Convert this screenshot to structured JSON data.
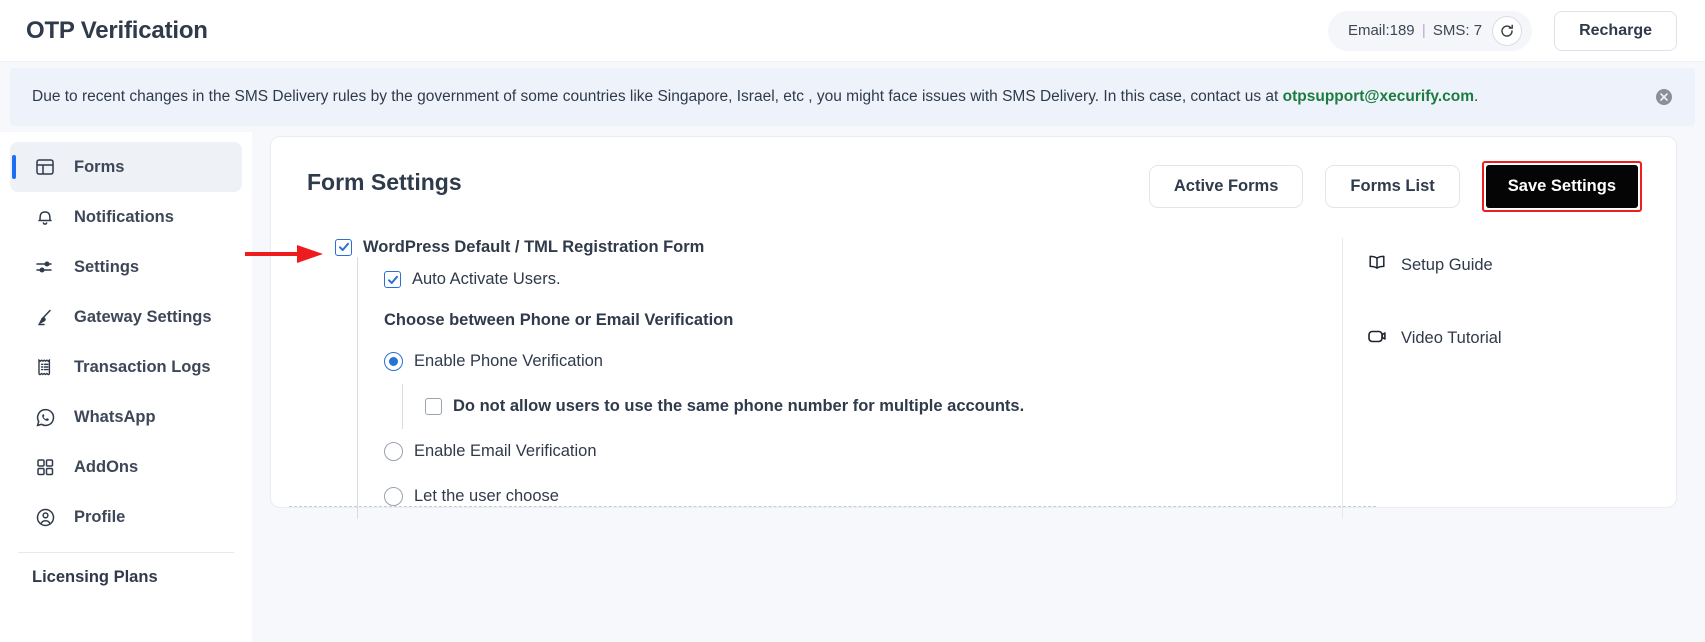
{
  "header": {
    "title": "OTP Verification",
    "credits_email_label": "Email:189",
    "credits_separator": "|",
    "credits_sms_label": "SMS: 7",
    "refresh_icon": "refresh-icon",
    "recharge_label": "Recharge"
  },
  "notice": {
    "text_before_link": "Due to recent changes in the SMS Delivery rules by the government of some countries like Singapore, Israel, etc , you might face issues with SMS Delivery. In this case, contact us at ",
    "link": "otpsupport@xecurify.com",
    "text_after_link": ".",
    "close_icon": "close-circle-icon"
  },
  "sidebar": {
    "items": [
      {
        "label": "Forms",
        "icon": "layout-icon",
        "active": true
      },
      {
        "label": "Notifications",
        "icon": "bell-icon",
        "active": false
      },
      {
        "label": "Settings",
        "icon": "sliders-icon",
        "active": false
      },
      {
        "label": "Gateway Settings",
        "icon": "brush-icon",
        "active": false
      },
      {
        "label": "Transaction Logs",
        "icon": "receipt-icon",
        "active": false
      },
      {
        "label": "WhatsApp",
        "icon": "whatsapp-icon",
        "active": false
      },
      {
        "label": "AddOns",
        "icon": "grid-icon",
        "active": false
      },
      {
        "label": "Profile",
        "icon": "user-circle-icon",
        "active": false
      }
    ],
    "footer_item": "Licensing Plans"
  },
  "main": {
    "card_title": "Form Settings",
    "buttons": {
      "active_forms": "Active Forms",
      "forms_list": "Forms List",
      "save_settings": "Save Settings"
    },
    "form_checkbox": {
      "label": "WordPress Default / TML Registration Form",
      "checked": true
    },
    "auto_activate": {
      "label": "Auto Activate Users.",
      "checked": true
    },
    "choose_heading": "Choose between Phone or Email Verification",
    "verification_options": [
      {
        "label": "Enable Phone Verification",
        "selected": true
      },
      {
        "label": "Enable Email Verification",
        "selected": false
      },
      {
        "label": "Let the user choose",
        "selected": false
      }
    ],
    "phone_suboption": {
      "label": "Do not allow users to use the same phone number for multiple accounts.",
      "checked": false
    },
    "side_links": [
      {
        "label": "Setup Guide",
        "icon": "book-icon"
      },
      {
        "label": "Video Tutorial",
        "icon": "video-camera-icon"
      }
    ]
  },
  "colors": {
    "accent_blue": "#1d6ef5",
    "checkbox_blue": "#2573d4",
    "link_green": "#1c7c3f",
    "highlight_red": "#f01d1d",
    "save_button_bg": "#050505"
  }
}
